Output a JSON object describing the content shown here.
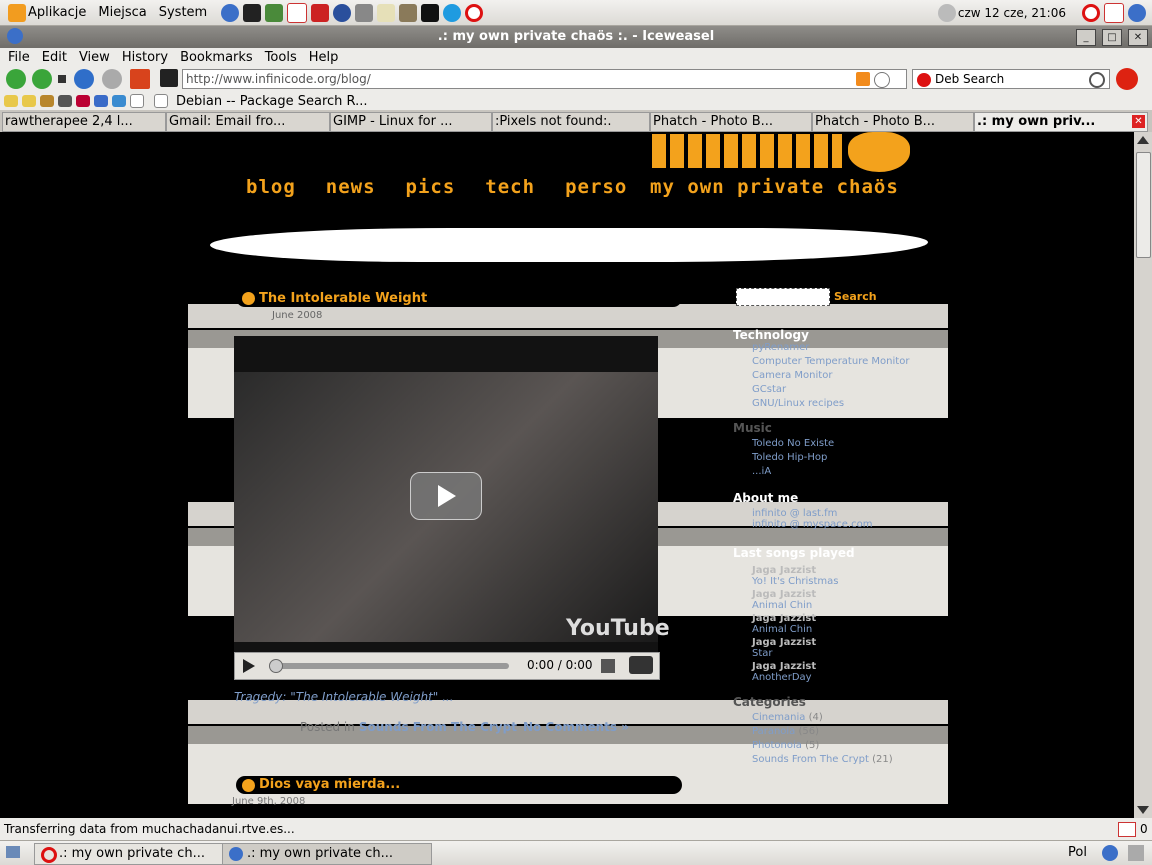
{
  "panel": {
    "apps": "Aplikacje",
    "places": "Miejsca",
    "system": "System",
    "clock": "czw 12 cze, 21:06"
  },
  "window": {
    "title": ".: my own private chaös :. - Iceweasel"
  },
  "menus": [
    "File",
    "Edit",
    "View",
    "History",
    "Bookmarks",
    "Tools",
    "Help"
  ],
  "nav": {
    "url": "http://www.infinicode.org/blog/",
    "search_placeholder": "Deb Search"
  },
  "bookmarks": {
    "label": "Debian -- Package Search R..."
  },
  "tabs": [
    "rawtherapee 2,4 l...",
    "Gmail: Email fro...",
    "GIMP - Linux for ...",
    ":Pixels not found:.",
    "Phatch - Photo B...",
    "Phatch - Photo B...",
    ".: my own priv..."
  ],
  "site": {
    "nav": [
      "blog",
      "news",
      "pics",
      "tech",
      "perso"
    ],
    "tagline": "my own private chaös",
    "search_button": "Search",
    "post1_title": "The Intolerable Weight",
    "post1_date": "June 2008",
    "video_time": "0:00 / 0:00",
    "youtube": "YouTube",
    "post1_footer": "Tragedy: \"The Intolerable Weight\" ...",
    "posted_in": "Posted in",
    "post1_cat": "Sounds From The Crypt",
    "no_comments": "No Comments »",
    "post2_title": "Dios vaya mierda...",
    "post2_date": "June 9th, 2008"
  },
  "sidebar": {
    "tech_head": "Technology",
    "tech_items": [
      "pyRenamer",
      "Computer Temperature Monitor",
      "Camera Monitor",
      "GCstar",
      "GNU/Linux recipes"
    ],
    "music_head": "Music",
    "music_items": [
      "Toledo No Existe",
      "Toledo Hip-Hop",
      "...iA"
    ],
    "about_head": "About me",
    "about_items": [
      "infinito @ last.fm",
      "infinito @ myspace.com"
    ],
    "songs_head": "Last songs played",
    "songs": [
      {
        "artist": "Jaga Jazzist",
        "track": "Yo! It's Christmas"
      },
      {
        "artist": "Jaga Jazzist",
        "track": "Animal Chin"
      },
      {
        "artist": "Jaga Jazzist",
        "track": "Animal Chin"
      },
      {
        "artist": "Jaga Jazzist",
        "track": "Star"
      },
      {
        "artist": "Jaga Jazzist",
        "track": "AnotherDay"
      }
    ],
    "cat_head": "Categories",
    "cats": [
      {
        "name": "Cinemania",
        "count": "(4)"
      },
      {
        "name": "Paranoia",
        "count": "(56)"
      },
      {
        "name": "Photonoia",
        "count": "(5)"
      },
      {
        "name": "Sounds From The Crypt",
        "count": "(21)"
      }
    ]
  },
  "status": {
    "text": "Transferring data from muchachadanui.rtve.es...",
    "gmail_count": "0"
  },
  "taskbar": {
    "task1": ".: my own private ch...",
    "task2": ".: my own private ch...",
    "lang": "Pol"
  }
}
